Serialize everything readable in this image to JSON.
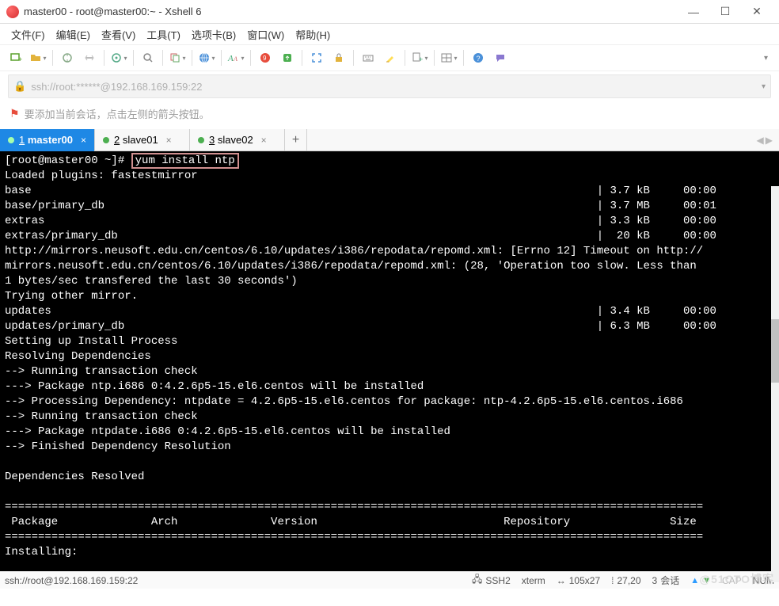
{
  "window": {
    "title": "master00 - root@master00:~ - Xshell 6"
  },
  "menu": {
    "file": "文件(F)",
    "edit": "编辑(E)",
    "view": "查看(V)",
    "tools": "工具(T)",
    "tabs": "选项卡(B)",
    "window": "窗口(W)",
    "help": "帮助(H)"
  },
  "address": {
    "url": "ssh://root:******@192.168.169.159:22"
  },
  "hint": {
    "text": "要添加当前会话，点击左侧的箭头按钮。"
  },
  "tabs": [
    {
      "num": "1",
      "label": "master00",
      "active": true
    },
    {
      "num": "2",
      "label": "slave01",
      "active": false
    },
    {
      "num": "3",
      "label": "slave02",
      "active": false
    }
  ],
  "terminal": {
    "prompt": "[root@master00 ~]# ",
    "command": "yum install ntp",
    "lines": [
      "Loaded plugins: fastestmirror",
      "base                                                                                     | 3.7 kB     00:00",
      "base/primary_db                                                                          | 3.7 MB     00:01",
      "extras                                                                                   | 3.3 kB     00:00",
      "extras/primary_db                                                                        |  20 kB     00:00",
      "http://mirrors.neusoft.edu.cn/centos/6.10/updates/i386/repodata/repomd.xml: [Errno 12] Timeout on http://",
      "mirrors.neusoft.edu.cn/centos/6.10/updates/i386/repodata/repomd.xml: (28, 'Operation too slow. Less than ",
      "1 bytes/sec transfered the last 30 seconds')",
      "Trying other mirror.",
      "updates                                                                                  | 3.4 kB     00:00",
      "updates/primary_db                                                                       | 6.3 MB     00:00",
      "Setting up Install Process",
      "Resolving Dependencies",
      "--> Running transaction check",
      "---> Package ntp.i686 0:4.2.6p5-15.el6.centos will be installed",
      "--> Processing Dependency: ntpdate = 4.2.6p5-15.el6.centos for package: ntp-4.2.6p5-15.el6.centos.i686",
      "--> Running transaction check",
      "---> Package ntpdate.i686 0:4.2.6p5-15.el6.centos will be installed",
      "--> Finished Dependency Resolution",
      "",
      "Dependencies Resolved",
      "",
      "=========================================================================================================",
      " Package              Arch              Version                            Repository               Size",
      "=========================================================================================================",
      "Installing:"
    ]
  },
  "status": {
    "left": "ssh://root@192.168.169.159:22",
    "protocol": "SSH2",
    "termtype": "xterm",
    "size": "105x27",
    "cursor": "27,20",
    "sessions_num": "3",
    "sessions_label": "会话",
    "caps": "CAP",
    "num": "NUM"
  },
  "watermark": "@51CTO博客"
}
